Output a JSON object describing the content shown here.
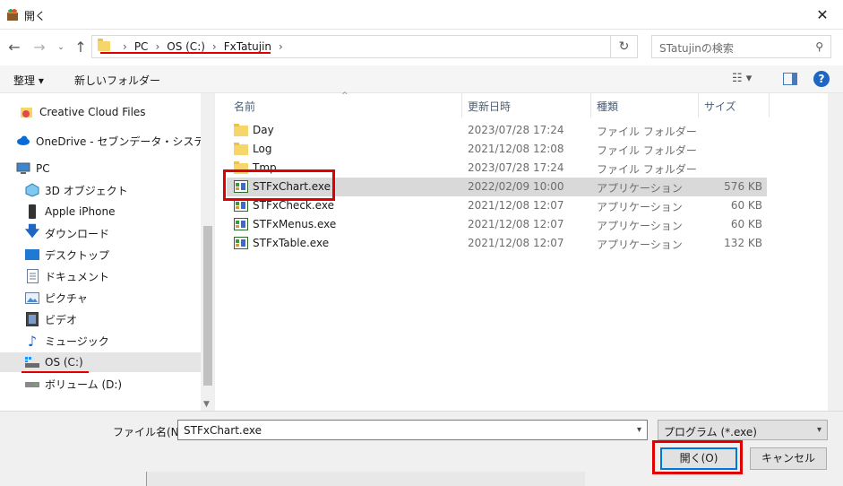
{
  "window": {
    "title": "開く",
    "close_icon": "close-icon"
  },
  "nav": {
    "back_icon": "arrow-left-icon",
    "forward_icon": "arrow-right-icon",
    "recent_icon": "chevron-down-icon",
    "up_icon": "arrow-up-icon",
    "breadcrumbs": [
      "PC",
      "OS (C:)",
      "FxTatujin"
    ],
    "search_placeholder": "STatujinの検索"
  },
  "toolbar": {
    "organize_label": "整理 ▾",
    "new_folder_label": "新しいフォルダー"
  },
  "sidebar": {
    "items": [
      {
        "label": "Creative Cloud Files",
        "icon": "creative-cloud-icon"
      },
      {
        "label": "OneDrive - セブンデータ・システムズ株式",
        "icon": "onedrive-icon"
      },
      {
        "label": "PC",
        "icon": "pc-icon"
      },
      {
        "label": "3D オブジェクト",
        "icon": "3d-objects-icon"
      },
      {
        "label": "Apple iPhone",
        "icon": "phone-icon"
      },
      {
        "label": "ダウンロード",
        "icon": "download-icon"
      },
      {
        "label": "デスクトップ",
        "icon": "desktop-icon"
      },
      {
        "label": "ドキュメント",
        "icon": "documents-icon"
      },
      {
        "label": "ピクチャ",
        "icon": "pictures-icon"
      },
      {
        "label": "ビデオ",
        "icon": "video-icon"
      },
      {
        "label": "ミュージック",
        "icon": "music-icon"
      },
      {
        "label": "OS (C:)",
        "icon": "drive-icon"
      },
      {
        "label": "ボリューム (D:)",
        "icon": "volume-icon"
      }
    ],
    "selected": "OS (C:)"
  },
  "columns": {
    "name": "名前",
    "modified": "更新日時",
    "type": "種類",
    "size": "サイズ"
  },
  "files": [
    {
      "name": "Day",
      "modified": "2023/07/28 17:24",
      "type": "ファイル フォルダー",
      "size": "",
      "icon": "folder-icon"
    },
    {
      "name": "Log",
      "modified": "2021/12/08 12:08",
      "type": "ファイル フォルダー",
      "size": "",
      "icon": "folder-icon"
    },
    {
      "name": "Tmp",
      "modified": "2023/07/28 17:24",
      "type": "ファイル フォルダー",
      "size": "",
      "icon": "folder-icon"
    },
    {
      "name": "STFxChart.exe",
      "modified": "2022/02/09 10:00",
      "type": "アプリケーション",
      "size": "576 KB",
      "icon": "exe-icon"
    },
    {
      "name": "STFxCheck.exe",
      "modified": "2021/12/08 12:07",
      "type": "アプリケーション",
      "size": "60 KB",
      "icon": "exe-icon"
    },
    {
      "name": "STFxMenus.exe",
      "modified": "2021/12/08 12:07",
      "type": "アプリケーション",
      "size": "60 KB",
      "icon": "exe-icon"
    },
    {
      "name": "STFxTable.exe",
      "modified": "2021/12/08 12:07",
      "type": "アプリケーション",
      "size": "132 KB",
      "icon": "exe-icon"
    }
  ],
  "bottom": {
    "filename_label": "ファイル名(N):",
    "filename_value": "STFxChart.exe",
    "filetype_value": "プログラム (*.exe)",
    "open_label": "開く(O)",
    "cancel_label": "キャンセル"
  },
  "colors": {
    "annotation": "#e00000",
    "accent": "#0078d7"
  }
}
